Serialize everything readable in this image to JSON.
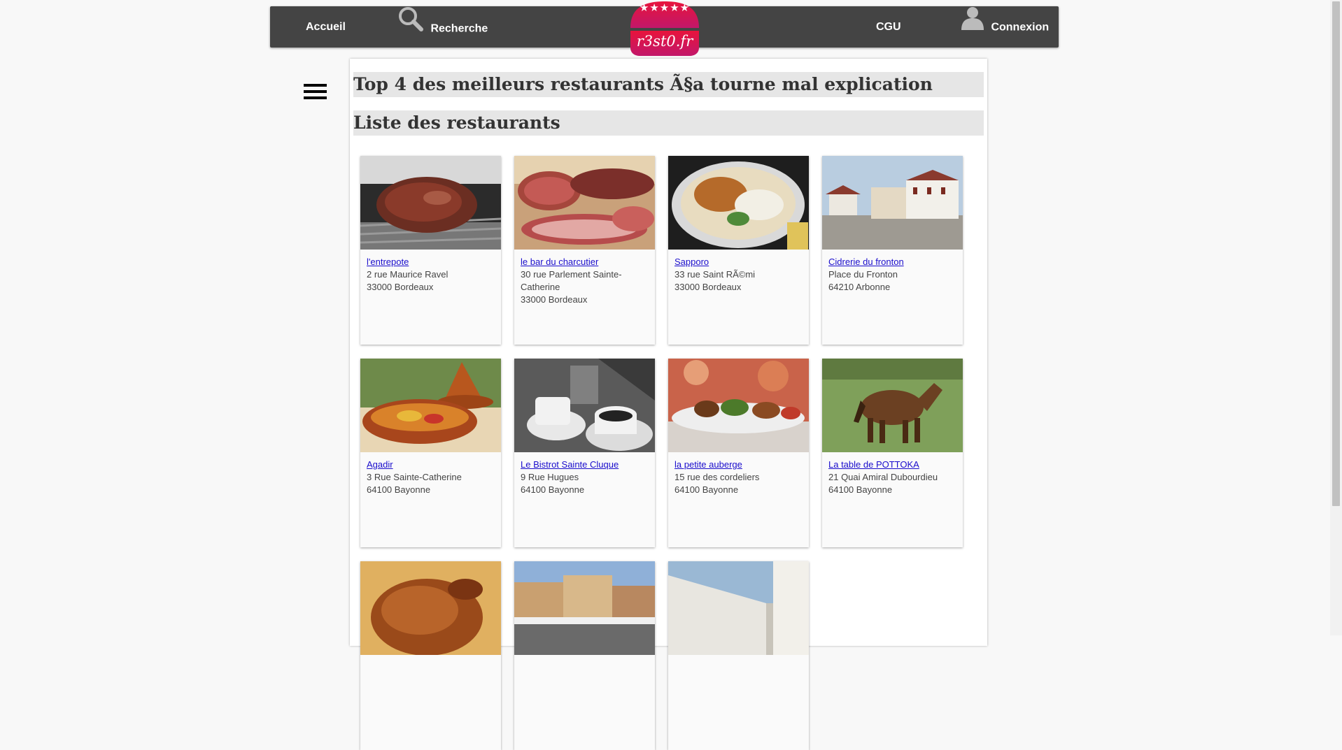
{
  "nav": {
    "home_label": "Accueil",
    "search_label": "Recherche",
    "cgu_label": "CGU",
    "login_label": "Connexion",
    "logo_text": "r3st0.fr",
    "logo_stars": "★★★★★"
  },
  "colors": {
    "navbar_bg": "#444444",
    "logo_top": "#e8143c",
    "logo_bottom": "#c2176a",
    "link": "#1a0dcc",
    "heading_bg": "#e6e6e6"
  },
  "page": {
    "top_title": "Top 4 des meilleurs restaurants Ã§a tourne mal explication",
    "list_title": "Liste des restaurants"
  },
  "restaurants": [
    {
      "name": "l'entrepote",
      "address": "2 rue Maurice Ravel",
      "city": "33000 Bordeaux",
      "photo": "grilled-steak-photo"
    },
    {
      "name": "le bar du charcutier",
      "address": "30 rue Parlement Sainte-Catherine",
      "city": "33000 Bordeaux",
      "photo": "charcuterie-photo"
    },
    {
      "name": "Sapporo",
      "address": "33 rue Saint RÃ©mi",
      "city": "33000 Bordeaux",
      "photo": "rice-bowl-photo"
    },
    {
      "name": "Cidrerie du fronton",
      "address": "Place du Fronton",
      "city": "64210 Arbonne",
      "photo": "fronton-village-photo"
    },
    {
      "name": "Agadir",
      "address": "3 Rue Sainte-Catherine",
      "city": "64100 Bayonne",
      "photo": "tajine-photo"
    },
    {
      "name": "Le Bistrot Sainte Cluque",
      "address": "9 Rue Hugues",
      "city": "64100 Bayonne",
      "photo": "coffee-cups-photo"
    },
    {
      "name": "la petite auberge",
      "address": "15 rue des cordeliers",
      "city": "64100 Bayonne",
      "photo": "tapas-plate-photo"
    },
    {
      "name": "La table de POTTOKA",
      "address": "21 Quai Amiral Dubourdieu",
      "city": "64100 Bayonne",
      "photo": "pottok-pony-photo"
    },
    {
      "name": "",
      "address": "",
      "city": "",
      "photo": "roast-chicken-photo"
    },
    {
      "name": "",
      "address": "",
      "city": "",
      "photo": "town-square-photo"
    },
    {
      "name": "",
      "address": "",
      "city": "",
      "photo": "white-wall-alley-photo"
    }
  ]
}
